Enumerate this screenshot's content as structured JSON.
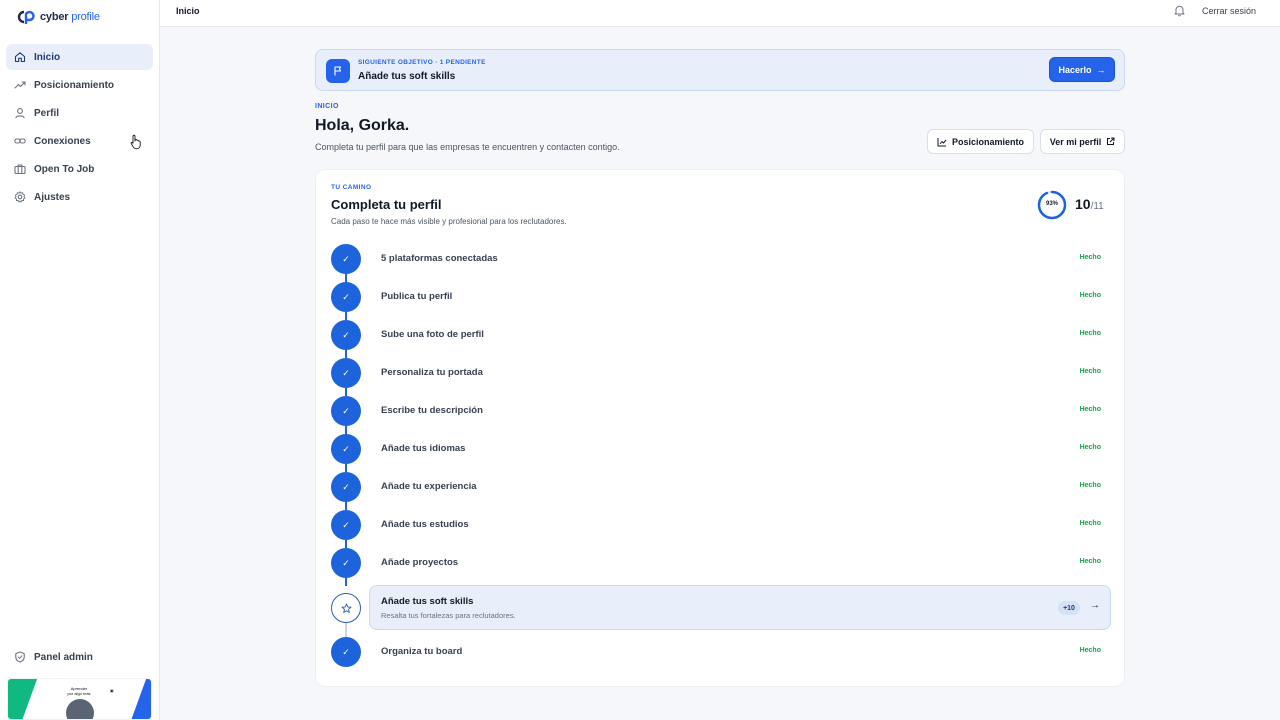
{
  "brand": {
    "name_a": "cyber",
    "name_b": "profile"
  },
  "sidebar": {
    "items": [
      {
        "label": "Inicio",
        "icon": "home-icon",
        "active": true
      },
      {
        "label": "Posicionamiento",
        "icon": "trending-up-icon"
      },
      {
        "label": "Perfil",
        "icon": "user-icon"
      },
      {
        "label": "Conexiones",
        "icon": "link-icon"
      },
      {
        "label": "Open To Job",
        "icon": "briefcase-icon"
      },
      {
        "label": "Ajustes",
        "icon": "gear-icon"
      }
    ],
    "admin_label": "Panel admin",
    "banner": {
      "line1": "Aprender",
      "line2": "por algo más"
    }
  },
  "topbar": {
    "breadcrumb": "Inicio",
    "logout": "Cerrar sesión"
  },
  "objective": {
    "label": "SIGUIENTE OBJETIVO · 1 PENDIENTE",
    "title": "Añade tus soft skills",
    "button": "Hacerlo"
  },
  "header": {
    "eyebrow": "INICIO",
    "greeting": "Hola, Gorka.",
    "subtitle": "Completa tu perfil para que las empresas te encuentren y contacten contigo.",
    "btn_positioning": "Posicionamiento",
    "btn_view_profile": "Ver mi perfil"
  },
  "path": {
    "eyebrow": "TU CAMINO",
    "title": "Completa tu perfil",
    "subtitle": "Cada paso te hace más visible y profesional para los reclutadores.",
    "progress_percent": 93,
    "progress_label": "93%",
    "done": "10",
    "total": "/11",
    "status_done": "Hecho",
    "steps": [
      {
        "label": "5 plataformas conectadas",
        "done": true
      },
      {
        "label": "Publica tu perfil",
        "done": true
      },
      {
        "label": "Sube una foto de perfil",
        "done": true
      },
      {
        "label": "Personaliza tu portada",
        "done": true
      },
      {
        "label": "Escribe tu descripción",
        "done": true
      },
      {
        "label": "Añade tus idiomas",
        "done": true
      },
      {
        "label": "Añade tu experiencia",
        "done": true
      },
      {
        "label": "Añade tus estudios",
        "done": true
      },
      {
        "label": "Añade proyectos",
        "done": true
      }
    ],
    "active_step": {
      "title": "Añade tus soft skills",
      "subtitle": "Resalta tus fortalezas para reclutadores.",
      "badge": "+10"
    },
    "last_step": {
      "label": "Organiza tu board",
      "status": "Hecho"
    }
  }
}
